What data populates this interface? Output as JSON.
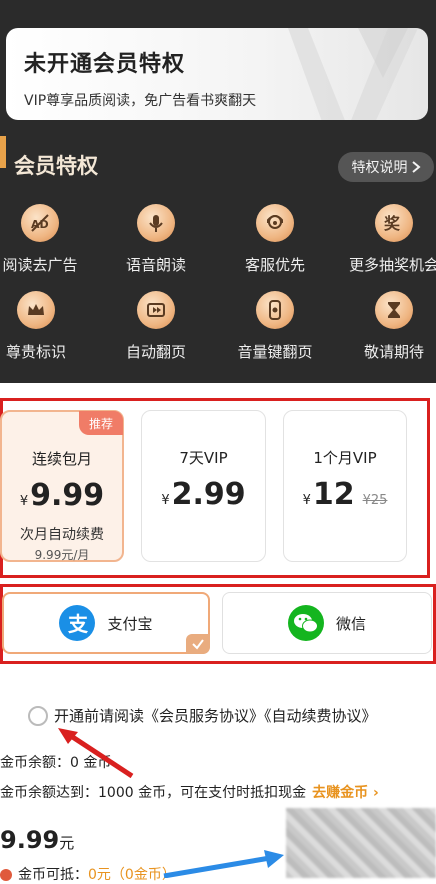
{
  "member_card": {
    "title": "未开通会员特权",
    "subtitle": "VIP尊享品质阅读，免广告看书爽翻天"
  },
  "privileges": {
    "title": "会员特权",
    "explain_label": "特权说明",
    "items": [
      {
        "label": "阅读去广告",
        "icon": "no-ad-icon"
      },
      {
        "label": "语音朗读",
        "icon": "microphone-icon"
      },
      {
        "label": "客服优先",
        "icon": "customer-service-icon"
      },
      {
        "label": "更多抽奖机会",
        "icon": "lottery-icon"
      },
      {
        "label": "尊贵标识",
        "icon": "crown-icon"
      },
      {
        "label": "自动翻页",
        "icon": "auto-page-icon"
      },
      {
        "label": "音量键翻页",
        "icon": "volume-key-icon"
      },
      {
        "label": "敬请期待",
        "icon": "hourglass-icon"
      }
    ]
  },
  "plans": [
    {
      "name": "连续包月",
      "currency": "¥",
      "price": "9.99",
      "note": "次月自动续费",
      "subnote": "9.99元/月",
      "badge": "推荐",
      "selected": true
    },
    {
      "name": "7天VIP",
      "currency": "¥",
      "price": "2.99",
      "selected": false
    },
    {
      "name": "1个月VIP",
      "currency": "¥",
      "price": "12",
      "old_price": "¥25",
      "selected": false
    }
  ],
  "payment": {
    "alipay_label": "支付宝",
    "wechat_label": "微信",
    "selected": "alipay"
  },
  "agreement": {
    "text": "开通前请阅读《会员服务协议》《自动续费协议》"
  },
  "coins": {
    "balance_text": "金币余额：0 金币",
    "threshold_text": "金币余额达到：1000 金币，可在支付时抵扣现金",
    "earn_link": "去赚金币 ›"
  },
  "total": {
    "amount": "9.99",
    "unit": "元"
  },
  "deduct": {
    "label": "金币可抵：",
    "value": "0元（0金币）"
  },
  "colors": {
    "accent": "#e8a24a",
    "dark_bg": "#2b2b2b",
    "annotation_red": "#d9201f",
    "annotation_blue": "#2b8be6"
  }
}
